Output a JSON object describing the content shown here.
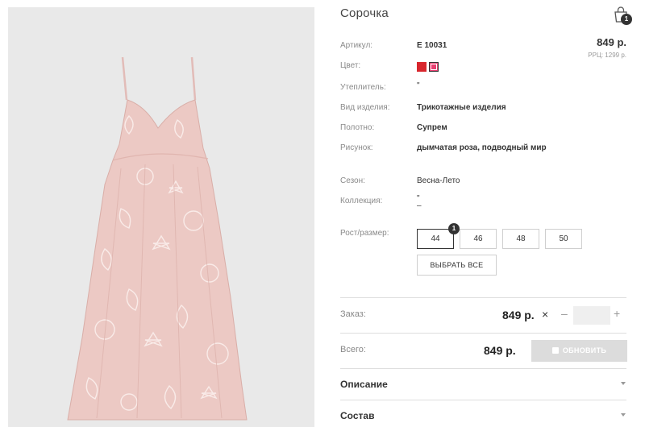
{
  "product": {
    "title": "Сорочка",
    "price": "849 р.",
    "rrp": "РРЦ: 1299 р.",
    "cart_count": "1"
  },
  "specs": {
    "article_label": "Артикул:",
    "article_value": "E 10031",
    "color_label": "Цвет:",
    "colors": [
      "#d8262d",
      "#e83f70"
    ],
    "insulation_label": "Утеплитель:",
    "insulation_value": "\"",
    "type_label": "Вид изделия:",
    "type_value": "Трикотажные изделия",
    "fabric_label": "Полотно:",
    "fabric_value": "Супрем",
    "pattern_label": "Рисунок:",
    "pattern_value": "дымчатая роза, подводный мир",
    "season_label": "Сезон:",
    "season_value": "Весна-Лето",
    "collection_label": "Коллекция:",
    "collection_value": "\"",
    "collection_value2": "–"
  },
  "sizes": {
    "label": "Рост/размер:",
    "options": [
      "44",
      "46",
      "48",
      "50"
    ],
    "selected_badge": "1",
    "select_all": "ВЫБРАТЬ ВСЕ"
  },
  "order": {
    "label": "Заказ:",
    "price": "849 р.",
    "times": "×",
    "minus": "–",
    "plus": "+",
    "quantity": ""
  },
  "total": {
    "label": "Всего:",
    "price": "849 р.",
    "update_button": "ОБНОВИТЬ"
  },
  "accordion": {
    "description": "Описание",
    "composition": "Состав"
  }
}
